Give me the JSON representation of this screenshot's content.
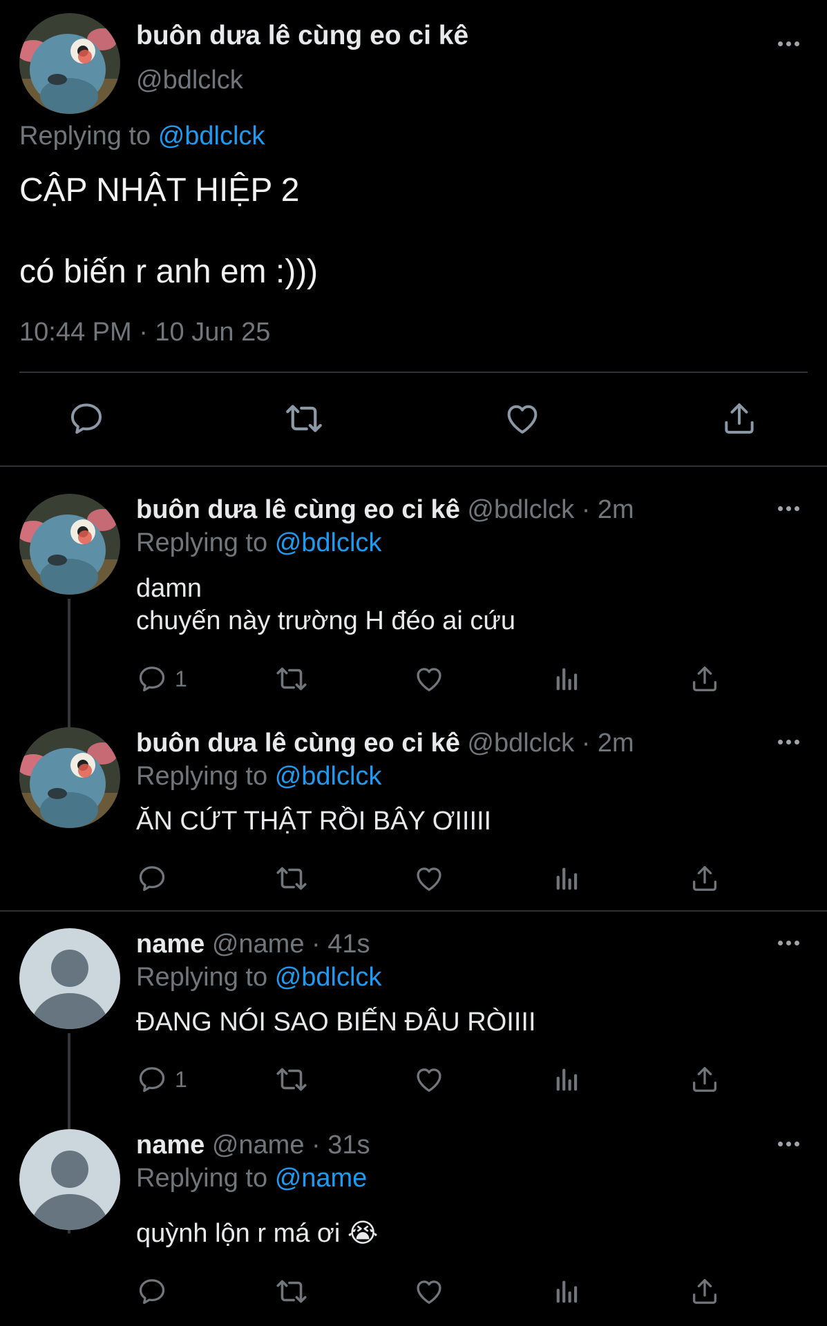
{
  "main_tweet": {
    "display_name": "buôn dưa lê cùng eo ci kê",
    "handle": "@bdlclck",
    "replying_prefix": "Replying to",
    "replying_to": "@bdlclck",
    "text_line1": "CẬP NHẬT HIỆP 2",
    "text_line2": "có biến r anh em :)))",
    "timestamp": "10:44 PM · 10 Jun 25",
    "actions": [
      "reply-icon",
      "retweet-icon",
      "like-icon",
      "share-icon"
    ]
  },
  "replies": [
    {
      "display_name": "buôn dưa lê cùng eo ci kê",
      "handle": "@bdlclck",
      "time": "· 2m",
      "replying_prefix": "Replying to",
      "replying_to": "@bdlclck",
      "text": [
        "damn",
        "chuyến này trường H đéo ai cứu"
      ],
      "reply_count": "1",
      "avatar": "mouse-avatar"
    },
    {
      "display_name": "buôn dưa lê cùng eo ci kê",
      "handle": "@bdlclck",
      "time": "· 2m",
      "replying_prefix": "Replying to",
      "replying_to": "@bdlclck",
      "text": [
        "ĂN CỨT THẬT RỒI BÂY ƠIIIII"
      ],
      "reply_count": "",
      "avatar": "mouse-avatar"
    },
    {
      "display_name": "name",
      "handle": "@name",
      "time": "· 41s",
      "replying_prefix": "Replying to",
      "replying_to": "@bdlclck",
      "text": [
        "ĐANG NÓI SAO BIẾN ĐÂU RÒIIII"
      ],
      "reply_count": "1",
      "avatar": "default-avatar"
    },
    {
      "display_name": "name",
      "handle": "@name",
      "time": "· 31s",
      "replying_prefix": "Replying to",
      "replying_to": "@name",
      "text": [
        "quỳnh lộn r má ơi 😭"
      ],
      "reply_count": "",
      "avatar": "default-avatar"
    }
  ],
  "colors": {
    "background": "#000000",
    "text": "#e7e9ea",
    "muted": "#71767b",
    "link": "#1d9bf0",
    "divider": "#2f3336"
  }
}
